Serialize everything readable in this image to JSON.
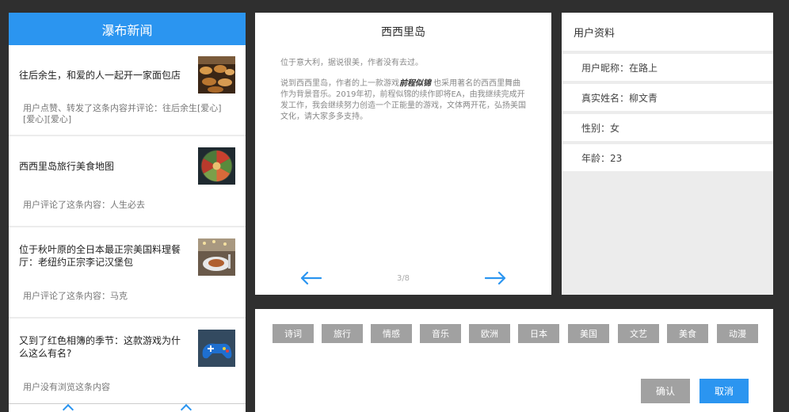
{
  "colors": {
    "accent": "#2b95f0",
    "tag_bg": "#a1a1a1",
    "app_bg": "#2f2f2f"
  },
  "feed": {
    "header": "瀑布新闻",
    "items": [
      {
        "title": "往后余生，和爱的人一起开一家面包店",
        "comment": "用户点赞、转发了这条内容并评论：往后余生[爱心][爱心][爱心]",
        "thumb": "bakery-image"
      },
      {
        "title": "西西里岛旅行美食地图",
        "comment": "用户评论了这条内容：人生必去",
        "thumb": "food-platter-image"
      },
      {
        "title": "位于秋叶原的全日本最正宗美国料理餐厅：老纽约正宗李记汉堡包",
        "comment": "用户评论了这条内容：马克",
        "thumb": "restaurant-image"
      },
      {
        "title": "又到了红色相簿的季节：这款游戏为什么这么有名?",
        "comment": "用户没有浏览这条内容",
        "thumb": "game-controller-image"
      }
    ]
  },
  "article": {
    "title": "西西里岛",
    "para1": "位于意大利，据说很美，作者没有去过。",
    "para2_a": "说到西西里岛，作者的上一款游戏",
    "para2_game": "前程似锦",
    "para2_b": " 也采用著名的西西里舞曲作为背景音乐。2019年初，前程似锦的续作即将EA，由我继续完成开发工作，我会继续努力创造一个正能量的游戏，文体两开花，弘扬美国文化，请大家多多支持。",
    "page": "3/8",
    "prev_icon": "arrow-left-icon",
    "next_icon": "arrow-right-icon"
  },
  "profile": {
    "header": "用户资料",
    "rows": [
      "用户昵称：在路上",
      "真实姓名：柳文青",
      "性别：女",
      "年龄：23"
    ]
  },
  "tags": {
    "items": [
      "诗词",
      "旅行",
      "情感",
      "音乐",
      "欧洲",
      "日本",
      "美国",
      "文艺",
      "美食",
      "动漫"
    ],
    "confirm": "确认",
    "cancel": "取消"
  }
}
